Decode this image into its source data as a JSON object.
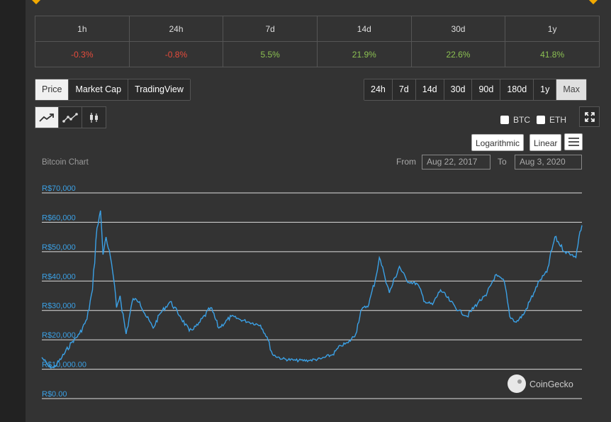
{
  "performance": {
    "periods": [
      "1h",
      "24h",
      "7d",
      "14d",
      "30d",
      "1y"
    ],
    "changes": [
      {
        "value": "-0.3%",
        "trend": "negative"
      },
      {
        "value": "-0.8%",
        "trend": "negative"
      },
      {
        "value": "5.5%",
        "trend": "positive"
      },
      {
        "value": "21.9%",
        "trend": "positive"
      },
      {
        "value": "22.6%",
        "trend": "positive"
      },
      {
        "value": "41.8%",
        "trend": "positive"
      }
    ]
  },
  "metric_tabs": [
    "Price",
    "Market Cap",
    "TradingView"
  ],
  "active_metric": "Price",
  "time_ranges": [
    "24h",
    "7d",
    "14d",
    "30d",
    "90d",
    "180d",
    "1y",
    "Max"
  ],
  "active_range": "Max",
  "chart_types": [
    {
      "icon": "line-chart-icon",
      "active": true
    },
    {
      "icon": "line-markers-chart-icon",
      "active": false
    },
    {
      "icon": "candlestick-chart-icon",
      "active": false
    }
  ],
  "compare": {
    "btc_label": "BTC",
    "eth_label": "ETH"
  },
  "scale": {
    "log_label": "Logarithmic",
    "linear_label": "Linear"
  },
  "range_picker": {
    "from_label": "From",
    "from_value": "Aug 22, 2017",
    "to_label": "To",
    "to_value": "Aug 3, 2020"
  },
  "watermark": "CoinGecko",
  "colors": {
    "line": "#3ba1e6",
    "positive": "#8cc152",
    "negative": "#e74c3c",
    "background": "#333333"
  },
  "chart_data": {
    "type": "line",
    "title": "Bitcoin Chart",
    "x_start": "2017-08-22",
    "x_end": "2020-08-03",
    "ylim": [
      0,
      70000
    ],
    "y_ticks": [
      "R$0.00",
      "R$10,000.00",
      "R$20,000",
      "R$30,000",
      "R$40,000",
      "R$50,000",
      "R$60,000",
      "R$70,000"
    ],
    "grid": true,
    "series": [
      {
        "x": [
          "2017-08-22",
          "2017-09-05",
          "2017-09-15",
          "2017-10-01",
          "2017-10-20",
          "2017-11-05",
          "2017-11-20",
          "2017-12-01",
          "2017-12-10",
          "2017-12-17",
          "2017-12-22",
          "2017-12-28",
          "2018-01-06",
          "2018-01-12",
          "2018-01-18",
          "2018-01-25",
          "2018-02-06",
          "2018-02-20",
          "2018-03-05",
          "2018-03-15",
          "2018-04-01",
          "2018-04-15",
          "2018-05-05",
          "2018-05-25",
          "2018-06-12",
          "2018-06-29",
          "2018-07-25",
          "2018-08-10",
          "2018-09-04",
          "2018-09-20",
          "2018-10-10",
          "2018-11-01",
          "2018-11-14",
          "2018-11-25",
          "2018-12-15",
          "2019-01-10",
          "2019-02-05",
          "2019-03-01",
          "2019-03-25",
          "2019-04-10",
          "2019-04-25",
          "2019-05-10",
          "2019-05-20",
          "2019-06-05",
          "2019-06-20",
          "2019-06-26",
          "2019-07-05",
          "2019-07-16",
          "2019-08-05",
          "2019-08-20",
          "2019-09-10",
          "2019-09-25",
          "2019-10-10",
          "2019-10-26",
          "2019-11-15",
          "2019-12-01",
          "2019-12-18",
          "2020-01-10",
          "2020-01-25",
          "2020-02-12",
          "2020-03-01",
          "2020-03-12",
          "2020-03-25",
          "2020-04-10",
          "2020-04-29",
          "2020-05-10",
          "2020-05-25",
          "2020-06-10",
          "2020-06-30",
          "2020-07-15",
          "2020-07-22",
          "2020-07-28",
          "2020-08-03"
        ],
        "values": [
          14000,
          11000,
          10500,
          14000,
          19000,
          22000,
          27000,
          37000,
          58000,
          64000,
          49000,
          55000,
          48000,
          41000,
          31000,
          35000,
          22000,
          34000,
          33000,
          29000,
          24000,
          29000,
          33000,
          28000,
          23000,
          25000,
          31000,
          24000,
          28000,
          27000,
          26000,
          25000,
          21000,
          15000,
          13500,
          13000,
          13000,
          13500,
          15000,
          18000,
          19000,
          22000,
          30000,
          32000,
          42000,
          48000,
          43000,
          36000,
          45000,
          40000,
          39000,
          33000,
          32000,
          37000,
          33000,
          30000,
          28000,
          33000,
          35000,
          42000,
          40000,
          28000,
          26000,
          29000,
          36000,
          40000,
          43000,
          55000,
          50000,
          49000,
          48000,
          55000,
          59000
        ]
      }
    ]
  }
}
